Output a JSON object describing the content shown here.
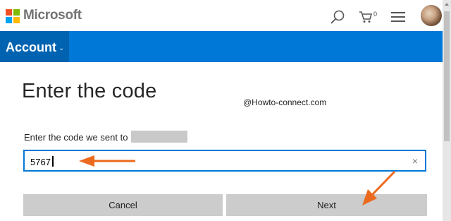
{
  "header": {
    "brand": "Microsoft",
    "cart_count": "0",
    "icons": [
      "microsoft-logo",
      "search-icon",
      "cart-icon",
      "menu-icon",
      "avatar"
    ]
  },
  "nav": {
    "account_label": "Account",
    "account_chevron": "⌄"
  },
  "main": {
    "heading": "Enter the code",
    "watermark": "@Howto-connect.com",
    "sent_label": "Enter the code we sent to",
    "code_value": "5767",
    "clear_glyph": "×",
    "cancel_label": "Cancel",
    "next_label": "Next"
  },
  "colors": {
    "accent": "#0078d7",
    "account_tab": "#0063b1",
    "annotation_arrow": "#ec6a1e",
    "button_bg": "#cccccc"
  }
}
